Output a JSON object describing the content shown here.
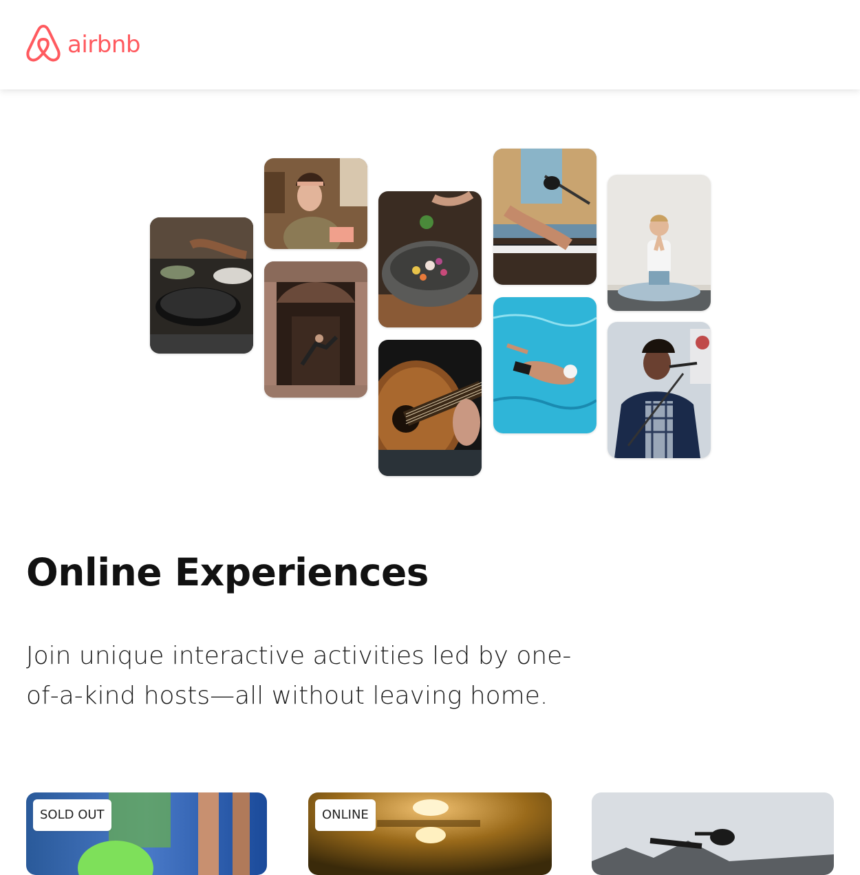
{
  "header": {
    "logo_text": "airbnb",
    "logo_icon": "airbnb-belo-icon",
    "brand_color": "#ff5a5f"
  },
  "hero": {
    "heading": "Online Experiences",
    "subtext": "Join unique interactive activities led by one-of-a-kind hosts—all without leaving home."
  },
  "photo_grid": [
    {
      "name": "cooking-photo"
    },
    {
      "name": "chef-woman-photo"
    },
    {
      "name": "dancer-doorway-photo"
    },
    {
      "name": "bowl-food-photo"
    },
    {
      "name": "guitar-photo"
    },
    {
      "name": "piano-microphone-photo"
    },
    {
      "name": "swimmer-photo"
    },
    {
      "name": "yoga-photo"
    },
    {
      "name": "singer-photo"
    }
  ],
  "cards": [
    {
      "badge": "SOLD OUT",
      "image": "sports-photo"
    },
    {
      "badge": "ONLINE",
      "image": "interior-lamp-photo"
    },
    {
      "badge": "",
      "image": "mountain-bike-photo"
    }
  ]
}
